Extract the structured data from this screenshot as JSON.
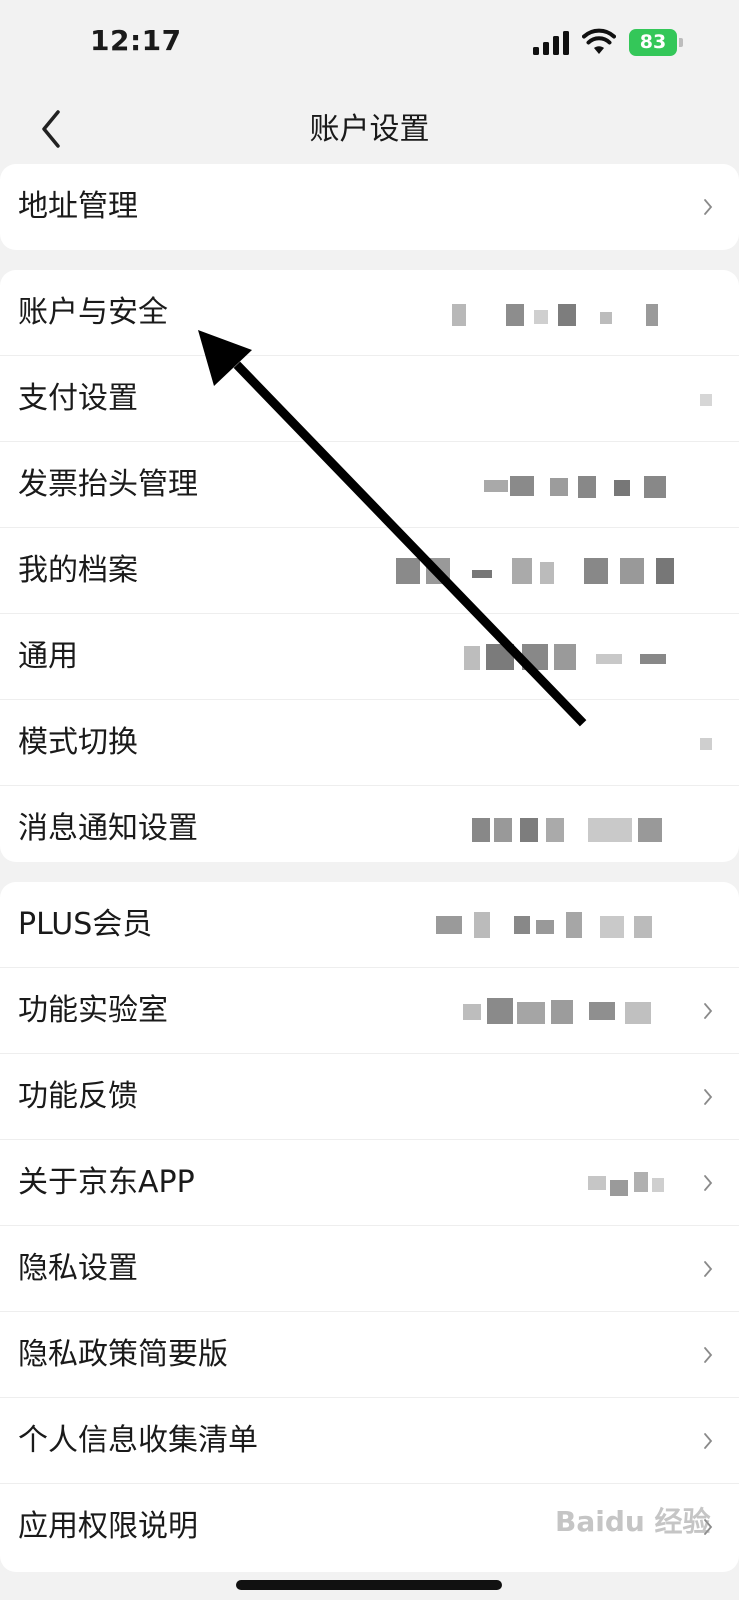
{
  "status": {
    "time": "12:17",
    "battery": "83"
  },
  "header": {
    "title": "账户设置"
  },
  "section1": {
    "items": [
      {
        "label": "地址管理"
      }
    ]
  },
  "section2": {
    "items": [
      {
        "label": "账户与安全"
      },
      {
        "label": "支付设置"
      },
      {
        "label": "发票抬头管理"
      },
      {
        "label": "我的档案"
      },
      {
        "label": "通用"
      },
      {
        "label": "模式切换"
      },
      {
        "label": "消息通知设置"
      }
    ]
  },
  "section3": {
    "items": [
      {
        "label": "PLUS会员"
      },
      {
        "label": "功能实验室"
      },
      {
        "label": "功能反馈"
      },
      {
        "label": "关于京东APP"
      },
      {
        "label": "隐私设置"
      },
      {
        "label": "隐私政策简要版"
      },
      {
        "label": "个人信息收集清单"
      },
      {
        "label": "应用权限说明"
      }
    ]
  },
  "watermark": "Baidu 经验",
  "colors": {
    "battery": "#34c759",
    "background": "#f2f2f2",
    "card": "#ffffff"
  }
}
